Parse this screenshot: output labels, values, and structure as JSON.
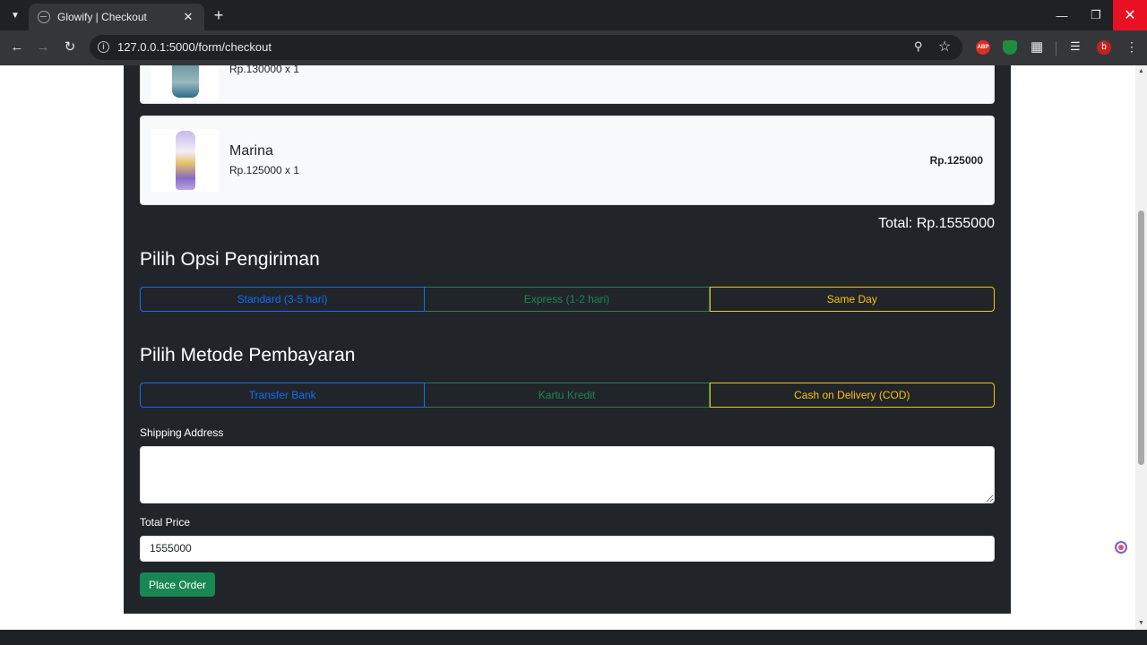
{
  "browser": {
    "tab_title": "Glowify | Checkout",
    "url": "127.0.0.1:5000/form/checkout",
    "extensions": {
      "abp": "ABP",
      "avatar": "b"
    }
  },
  "cart": {
    "items": [
      {
        "name": "",
        "qty_text": "Rp.130000 x 1",
        "subtotal": ""
      },
      {
        "name": "Marina",
        "qty_text": "Rp.125000 x 1",
        "subtotal": "Rp.125000"
      }
    ],
    "total_text": "Total: Rp.1555000"
  },
  "shipping": {
    "title": "Pilih Opsi Pengiriman",
    "options": [
      "Standard (3-5 hari)",
      "Express (1-2 hari)",
      "Same Day"
    ]
  },
  "payment": {
    "title": "Pilih Metode Pembayaran",
    "options": [
      "Transfer Bank",
      "Kartu Kredit",
      "Cash on Delivery (COD)"
    ]
  },
  "form": {
    "address_label": "Shipping Address",
    "address_value": "",
    "total_label": "Total Price",
    "total_value": "1555000",
    "submit_label": "Place Order"
  },
  "colors": {
    "primary": "#0d6efd",
    "success": "#198754",
    "warning": "#ffc107",
    "dark_bg": "#212529"
  }
}
